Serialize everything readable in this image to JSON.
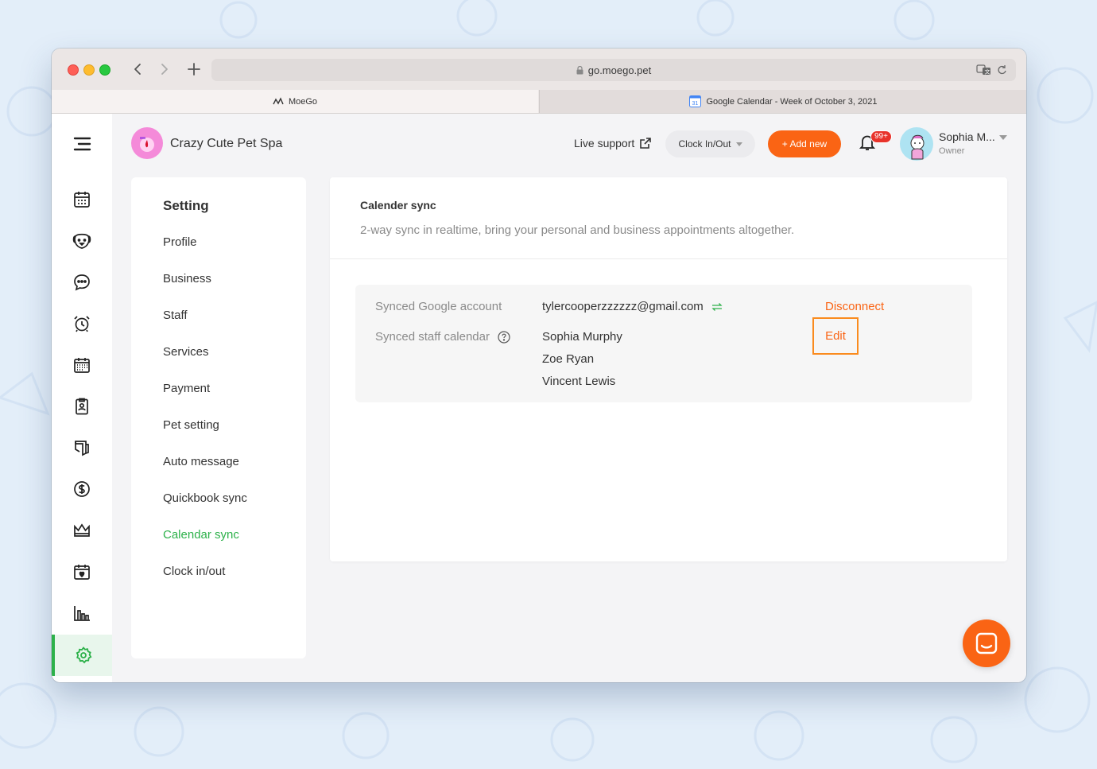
{
  "browser": {
    "url": "go.moego.pet",
    "tabs": [
      {
        "label": "MoeGo",
        "icon": "moego-logo-icon",
        "active": true
      },
      {
        "label": "Google Calendar - Week of October 3, 2021",
        "icon": "google-calendar-icon",
        "active": false
      }
    ]
  },
  "header": {
    "business_name": "Crazy Cute Pet Spa",
    "live_support": "Live support",
    "clock_label": "Clock In/Out",
    "add_new_label": "+ Add new",
    "notification_count": "99+",
    "user_name": "Sophia M...",
    "user_role": "Owner"
  },
  "sidebar": {
    "items": [
      {
        "icon": "menu-icon"
      },
      {
        "icon": "calendar-icon"
      },
      {
        "icon": "pet-icon"
      },
      {
        "icon": "chat-icon"
      },
      {
        "icon": "alarm-clock-icon"
      },
      {
        "icon": "schedule-icon"
      },
      {
        "icon": "clipboard-icon"
      },
      {
        "icon": "retail-icon"
      },
      {
        "icon": "dollar-icon"
      },
      {
        "icon": "crown-icon"
      },
      {
        "icon": "booking-icon"
      },
      {
        "icon": "reports-icon"
      },
      {
        "icon": "settings-icon",
        "active": true
      }
    ]
  },
  "settings_menu": {
    "title": "Setting",
    "items": [
      "Profile",
      "Business",
      "Staff",
      "Services",
      "Payment",
      "Pet setting",
      "Auto message",
      "Quickbook sync",
      "Calendar sync",
      "Clock in/out"
    ],
    "active_index": 8
  },
  "content": {
    "title": "Calender sync",
    "subtitle": "2-way sync in realtime, bring your personal and business appointments altogether.",
    "google_account_label": "Synced Google account",
    "google_account_value": "tylercooperzzzzzz@gmail.com",
    "staff_calendar_label": "Synced staff calendar",
    "staff": [
      "Sophia Murphy",
      "Zoe Ryan",
      "Vincent Lewis"
    ],
    "disconnect_label": "Disconnect",
    "edit_label": "Edit"
  },
  "colors": {
    "accent_green": "#2db14a",
    "accent_orange": "#fa6414",
    "badge_red": "#e8332b"
  }
}
